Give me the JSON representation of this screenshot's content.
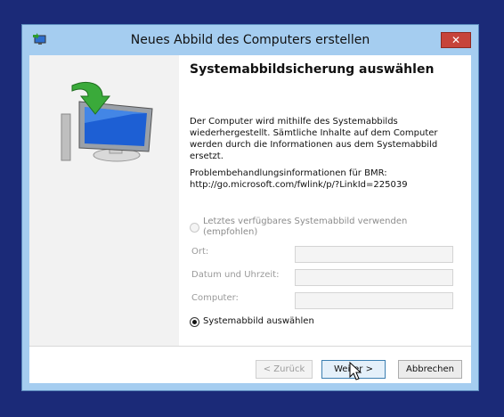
{
  "window": {
    "title": "Neues Abbild des Computers erstellen",
    "close_label": "✕"
  },
  "page": {
    "heading": "Systemabbildsicherung auswählen",
    "description": "Der Computer wird mithilfe des Systemabbilds\nwiederhergestellt. Sämtliche Inhalte auf dem Computer\nwerden durch die Informationen aus dem Systemabbild\nersetzt.",
    "info": "Problembehandlungsinformationen für BMR:\nhttp://go.microsoft.com/fwlink/p/?LinkId=225039"
  },
  "options": {
    "latest_image": {
      "label": "Letztes verfügbares Systemabbild verwenden\n(empfohlen)",
      "selected": false,
      "enabled": false
    },
    "choose_image": {
      "label": "Systemabbild auswählen",
      "selected": true,
      "enabled": true
    }
  },
  "fields": {
    "location_label": "Ort:",
    "location_value": "",
    "datetime_label": "Datum und Uhrzeit:",
    "datetime_value": "",
    "computer_label": "Computer:",
    "computer_value": ""
  },
  "buttons": {
    "back": "< Zurück",
    "next": "Weiter >",
    "cancel": "Abbrechen"
  },
  "icons": {
    "app": "system-restore-icon",
    "graphic": "computer-restore-icon",
    "cursor": "mouse-pointer-icon"
  },
  "colors": {
    "frame": "#a5cdf0",
    "close": "#c7443a",
    "desktop": "#1b2a78"
  }
}
